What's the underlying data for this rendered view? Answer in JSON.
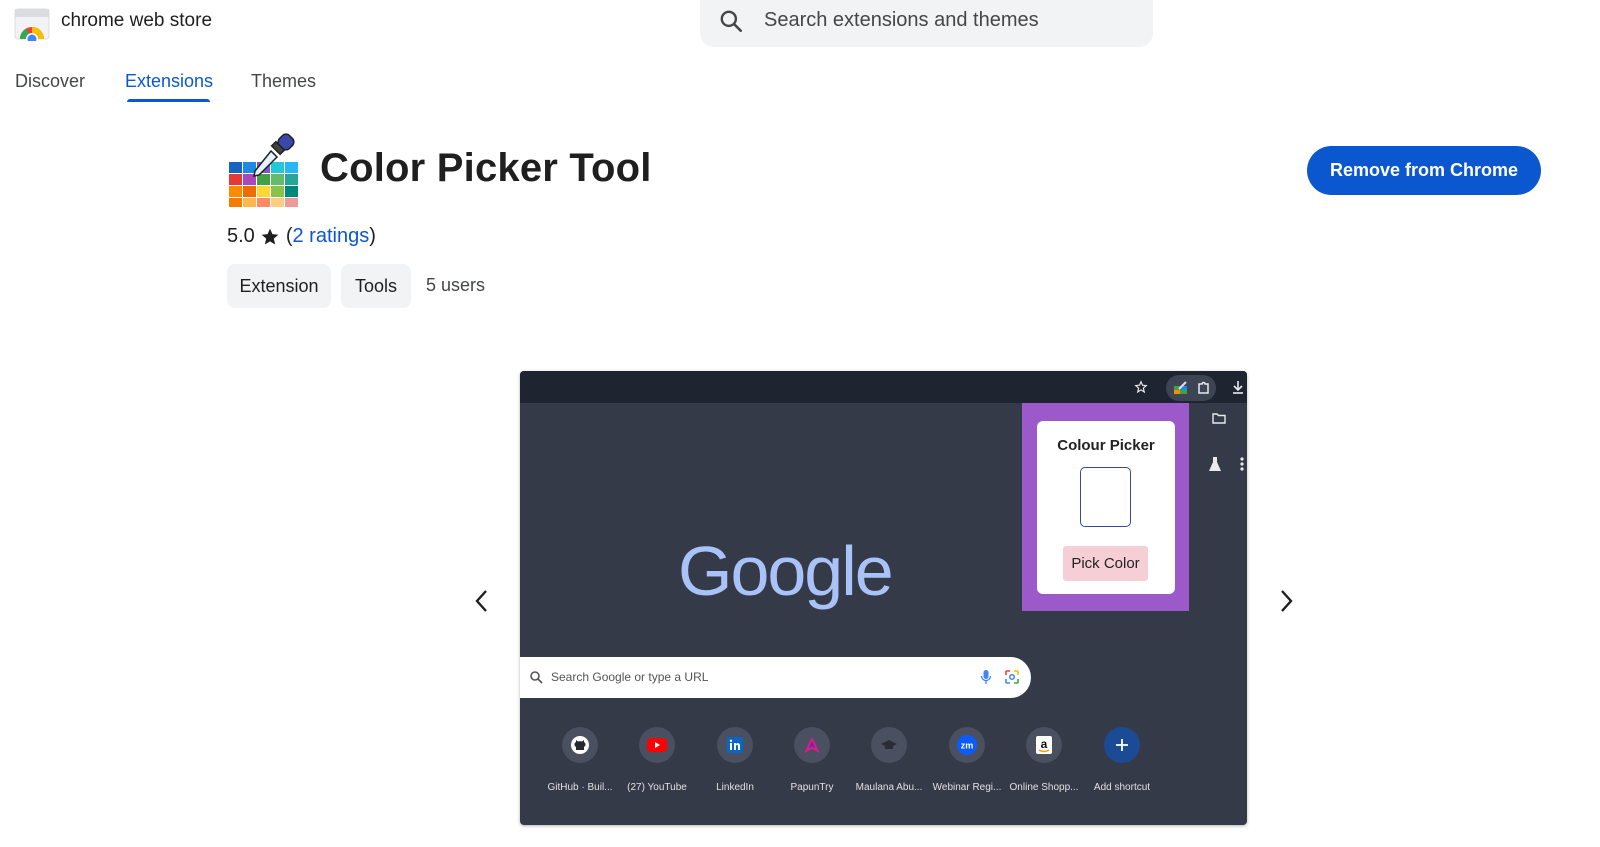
{
  "header": {
    "store_name": "chrome web store",
    "search_placeholder": "Search extensions and themes"
  },
  "tabs": [
    {
      "label": "Discover",
      "active": false
    },
    {
      "label": "Extensions",
      "active": true
    },
    {
      "label": "Themes",
      "active": false
    }
  ],
  "extension": {
    "title": "Color Picker Tool",
    "rating": "5.0",
    "ratings_link": "2 ratings",
    "chips": [
      "Extension",
      "Tools"
    ],
    "users": "5 users",
    "action_button": "Remove from Chrome"
  },
  "screenshot": {
    "popup_title": "Colour Picker",
    "pick_button": "Pick Color",
    "logo_text": "Google",
    "search_placeholder": "Search Google or type a URL",
    "shortcuts": [
      {
        "label": "GitHub · Buil...",
        "icon": "github-icon"
      },
      {
        "label": "(27) YouTube",
        "icon": "youtube-icon"
      },
      {
        "label": "LinkedIn",
        "icon": "linkedin-icon"
      },
      {
        "label": "PapunTry",
        "icon": "papuntry-icon"
      },
      {
        "label": "Maulana Abu...",
        "icon": "graduation-icon"
      },
      {
        "label": "Webinar Regi...",
        "icon": "zoom-icon"
      },
      {
        "label": "Online Shopp...",
        "icon": "amazon-icon"
      },
      {
        "label": "Add shortcut",
        "icon": "plus-icon"
      }
    ]
  },
  "colors": {
    "accent": "#0b57d0",
    "chip_bg": "#f1f3f4",
    "popup_bg": "#9b59c9",
    "pick_button_bg": "#f6cfd6"
  }
}
